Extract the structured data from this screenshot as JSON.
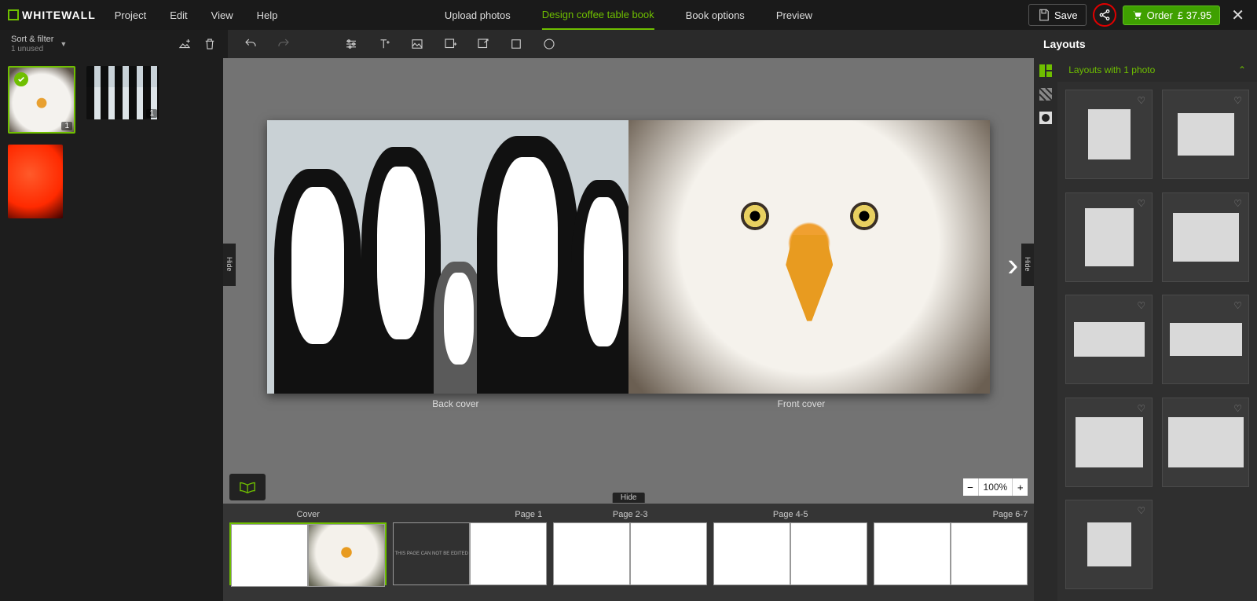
{
  "brand": "WHITEWALL",
  "top_menu": {
    "project": "Project",
    "edit": "Edit",
    "view": "View",
    "help": "Help"
  },
  "tabs": {
    "upload": "Upload photos",
    "design": "Design coffee table book",
    "options": "Book options",
    "preview": "Preview"
  },
  "top_right": {
    "save": "Save",
    "order": "Order",
    "price": "£ 37.95"
  },
  "photobar": {
    "title": "Sort & filter",
    "subtitle": "1 unused"
  },
  "thumbs": {
    "eagle_used": "1",
    "penguin_used": "1"
  },
  "canvas": {
    "back_cover": "Back cover",
    "front_cover": "Front cover",
    "hide": "Hide",
    "zoom": "100%"
  },
  "filmstrip": {
    "cover": "Cover",
    "p1": "Page 1",
    "p23": "Page 2-3",
    "p45": "Page 4-5",
    "p67": "Page 6-7",
    "locked_text": "THIS PAGE CAN NOT BE EDITED"
  },
  "right": {
    "title": "Layouts",
    "section": "Layouts with 1 photo"
  }
}
